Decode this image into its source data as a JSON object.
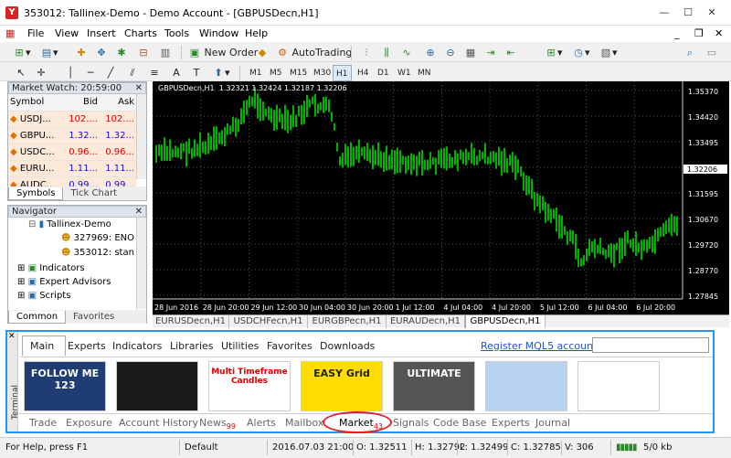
{
  "window": {
    "title": "353012: Tallinex-Demo - Demo Account - [GBPUSDecn,H1]"
  },
  "menu": [
    "File",
    "View",
    "Insert",
    "Charts",
    "Tools",
    "Window",
    "Help"
  ],
  "toolbar": {
    "new_order": "New Order",
    "autotrading": "AutoTrading"
  },
  "timeframes": [
    "M1",
    "M5",
    "M15",
    "M30",
    "H1",
    "H4",
    "D1",
    "W1",
    "MN"
  ],
  "selected_timeframe": "H1",
  "market_watch": {
    "title": "Market Watch: 20:59:00",
    "columns": [
      "Symbol",
      "Bid",
      "Ask"
    ],
    "rows": [
      {
        "symbol": "USDJ...",
        "bid": "102....",
        "ask": "102....",
        "color": "#d00000"
      },
      {
        "symbol": "GBPU...",
        "bid": "1.32...",
        "ask": "1.32...",
        "color": "#1010d0"
      },
      {
        "symbol": "USDC...",
        "bid": "0.96...",
        "ask": "0.96...",
        "color": "#d00000"
      },
      {
        "symbol": "EURU...",
        "bid": "1.11...",
        "ask": "1.11...",
        "color": "#1010d0"
      },
      {
        "symbol": "AUDC...",
        "bid": "0.99...",
        "ask": "0.99...",
        "color": "#1010d0"
      }
    ],
    "tabs": [
      "Symbols",
      "Tick Chart"
    ]
  },
  "navigator": {
    "title": "Navigator",
    "broker": "Tallinex-Demo",
    "accounts": [
      "327969: ENO E",
      "353012: stan b"
    ],
    "items": [
      "Indicators",
      "Expert Advisors",
      "Scripts"
    ],
    "tabs": [
      "Common",
      "Favorites"
    ]
  },
  "chart": {
    "header": "GBPUSDecn,H1  1.32321 1.32424 1.32187 1.32206",
    "price_labels": [
      "1.35370",
      "1.34420",
      "1.33495",
      "1.32545",
      "1.31595",
      "1.30670",
      "1.29720",
      "1.28770",
      "1.27845"
    ],
    "current_price": "1.32206",
    "time_labels": [
      "28 Jun 2016",
      "28 Jun 20:00",
      "29 Jun 12:00",
      "30 Jun 04:00",
      "30 Jun 20:00",
      "1 Jul 12:00",
      "4 Jul 04:00",
      "4 Jul 20:00",
      "5 Jul 12:00",
      "6 Jul 04:00",
      "6 Jul 20:00"
    ],
    "tabs": [
      "EURUSDecn,H1",
      "USDCHFecn,H1",
      "EURGBPecn,H1",
      "EURAUDecn,H1",
      "GBPUSDecn,H1"
    ],
    "active_tab": "GBPUSDecn,H1"
  },
  "terminal": {
    "side_label": "Terminal",
    "market_tabs": [
      "Main",
      "Experts",
      "Indicators",
      "Libraries",
      "Utilities",
      "Favorites",
      "Downloads"
    ],
    "register_link": "Register MQL5 account",
    "products": [
      {
        "name": "FOLLOW ME 123",
        "bg": "#1f3c73"
      },
      {
        "name": "",
        "bg": "#1a1a1a"
      },
      {
        "name": "Multi Timeframe Candles",
        "bg": "#ffffff"
      },
      {
        "name": "EASY Grid",
        "bg": "#ffdd00"
      },
      {
        "name": "ULTIMATE",
        "bg": "#555555"
      },
      {
        "name": "",
        "bg": "#b8d2f0"
      },
      {
        "name": "",
        "bg": "#ffffff"
      }
    ],
    "bottom_tabs": [
      "Trade",
      "Exposure",
      "Account History",
      "News",
      "Alerts",
      "Mailbox",
      "Market",
      "Signals",
      "Code Base",
      "Experts",
      "Journal"
    ],
    "news_count": "99",
    "market_count": "43",
    "active_bottom_tab": "Market"
  },
  "statusbar": {
    "help": "For Help, press F1",
    "profile": "Default",
    "datetime": "2016.07.03 21:00",
    "open": "O: 1.32511",
    "high": "H: 1.32792",
    "low": "L: 1.32499",
    "close": "C: 1.32785",
    "volume": "V: 306",
    "traffic": "5/0 kb"
  },
  "colors": {
    "accent": "#2196f3",
    "candle": "#00e000",
    "highlight": "#e02020"
  }
}
